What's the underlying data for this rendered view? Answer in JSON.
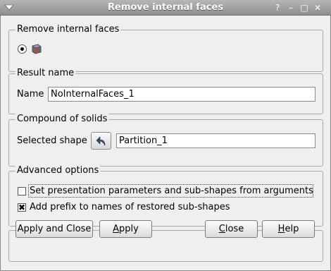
{
  "window": {
    "title": "Remove internal faces",
    "help_button": "?",
    "minimize_button": "–",
    "maximize_button": "□",
    "close_button": "✕"
  },
  "groups": {
    "mode": {
      "title": "Remove internal faces"
    },
    "result": {
      "title": "Result name",
      "name_label": "Name",
      "name_value": "NoInternalFaces_1"
    },
    "compound": {
      "title": "Compound of solids",
      "selected_label": "Selected shape",
      "selected_value": "Partition_1"
    },
    "advanced": {
      "title": "Advanced options",
      "option1": {
        "label": "Set presentation parameters and sub-shapes from arguments",
        "checked": false
      },
      "option2": {
        "label": "Add prefix to names of restored sub-shapes",
        "checked": true
      }
    }
  },
  "buttons": {
    "apply_close": "Apply and Close",
    "apply_first": "A",
    "apply_rest": "pply",
    "close_first": "C",
    "close_rest": "lose",
    "help_first": "H",
    "help_rest": "elp"
  },
  "icons": {
    "window": "window-menu-icon",
    "shape": "shape-icon",
    "select": "select-arrow-icon"
  }
}
